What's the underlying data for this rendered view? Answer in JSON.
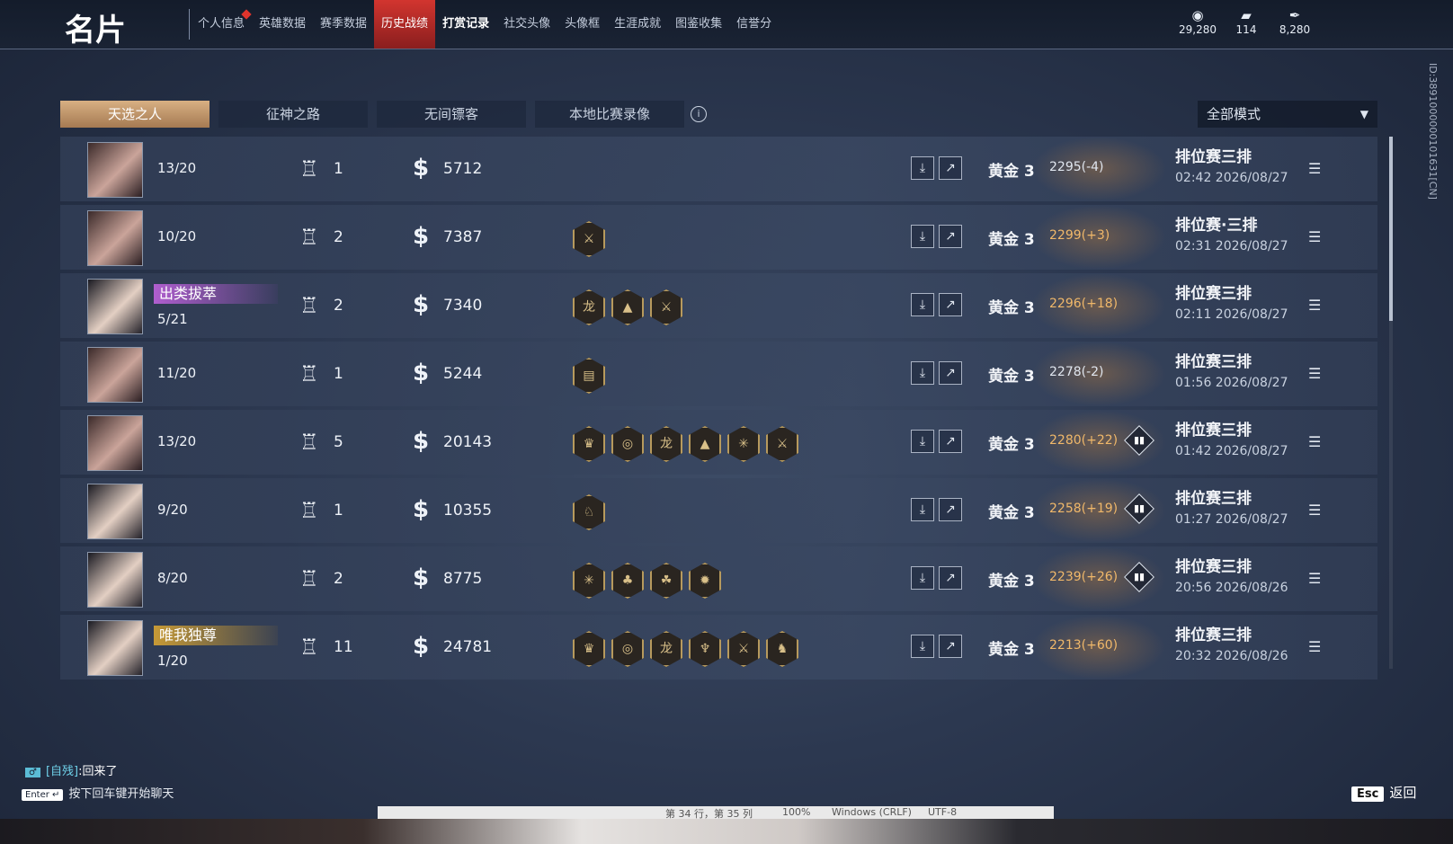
{
  "header": {
    "title": "名片",
    "tabs": [
      {
        "label": "个人信息",
        "notify": true
      },
      {
        "label": "英雄数据"
      },
      {
        "label": "赛季数据"
      },
      {
        "label": "历史战绩",
        "active": true
      },
      {
        "label": "打赏记录",
        "bold": true
      },
      {
        "label": "社交头像"
      },
      {
        "label": "头像框"
      },
      {
        "label": "生涯成就"
      },
      {
        "label": "图鉴收集"
      },
      {
        "label": "信誉分"
      }
    ],
    "currencies": [
      {
        "icon": "coin-stack-icon",
        "value": "29,280"
      },
      {
        "icon": "ticket-icon",
        "value": "114"
      },
      {
        "icon": "feather-icon",
        "value": "8,280"
      }
    ]
  },
  "mode_tabs": [
    "天选之人",
    "征神之路",
    "无间镖客",
    "本地比赛录像"
  ],
  "mode_select": "全部模式",
  "player_id": "ID:3891000000101631[CN]",
  "matches": [
    {
      "rank": "13/20",
      "wins": "1",
      "gold": "5712",
      "badges": [],
      "tier": "黄金 3",
      "score": "2295(-4)",
      "score_up": false,
      "stat": false,
      "type": "排位赛三排",
      "time": "02:42  2026/08/27",
      "avatar": "a"
    },
    {
      "rank": "10/20",
      "wins": "2",
      "gold": "7387",
      "badges": [
        "⚔"
      ],
      "tier": "黄金 3",
      "score": "2299(+3)",
      "score_up": true,
      "stat": false,
      "type": "排位赛·三排",
      "time": "02:31  2026/08/27",
      "avatar": "a"
    },
    {
      "tag": "出类拔萃",
      "tag_color": "purple",
      "rank": "5/21",
      "wins": "2",
      "gold": "7340",
      "badges": [
        "龙",
        "▲",
        "⚔"
      ],
      "tier": "黄金 3",
      "score": "2296(+18)",
      "score_up": true,
      "stat": false,
      "type": "排位赛三排",
      "time": "02:11  2026/08/27",
      "avatar": "b"
    },
    {
      "rank": "11/20",
      "wins": "1",
      "gold": "5244",
      "badges": [
        "▤"
      ],
      "tier": "黄金 3",
      "score": "2278(-2)",
      "score_up": false,
      "stat": false,
      "type": "排位赛三排",
      "time": "01:56  2026/08/27",
      "avatar": "a"
    },
    {
      "rank": "13/20",
      "wins": "5",
      "gold": "20143",
      "badges": [
        "♛",
        "◎",
        "龙",
        "▲",
        "✳",
        "⚔"
      ],
      "tier": "黄金 3",
      "score": "2280(+22)",
      "score_up": true,
      "stat": true,
      "type": "排位赛三排",
      "time": "01:42  2026/08/27",
      "avatar": "a"
    },
    {
      "rank": "9/20",
      "wins": "1",
      "gold": "10355",
      "badges": [
        "♘"
      ],
      "tier": "黄金 3",
      "score": "2258(+19)",
      "score_up": true,
      "stat": true,
      "type": "排位赛三排",
      "time": "01:27  2026/08/27",
      "avatar": "b"
    },
    {
      "rank": "8/20",
      "wins": "2",
      "gold": "8775",
      "badges": [
        "✳",
        "♣",
        "☘",
        "✹"
      ],
      "tier": "黄金 3",
      "score": "2239(+26)",
      "score_up": true,
      "stat": true,
      "type": "排位赛三排",
      "time": "20:56  2026/08/26",
      "avatar": "b"
    },
    {
      "tag": "唯我独尊",
      "tag_color": "gold",
      "rank": "1/20",
      "wins": "11",
      "gold": "24781",
      "badges": [
        "♛",
        "◎",
        "龙",
        "♆",
        "⚔",
        "♞"
      ],
      "tier": "黄金 3",
      "score": "2213(+60)",
      "score_up": true,
      "stat": false,
      "type": "排位赛三排",
      "time": "20:32  2026/08/26",
      "avatar": "b"
    }
  ],
  "chat": {
    "channel": "♂",
    "who": "[自残]",
    "msg": ":回来了"
  },
  "chat_hint": {
    "key": "Enter ↵",
    "text": "按下回车键开始聊天"
  },
  "esc": {
    "key": "Esc",
    "label": "返回"
  },
  "taskbar": [
    "第 34 行，第 35 列",
    "100%",
    "Windows (CRLF)",
    "UTF-8"
  ]
}
